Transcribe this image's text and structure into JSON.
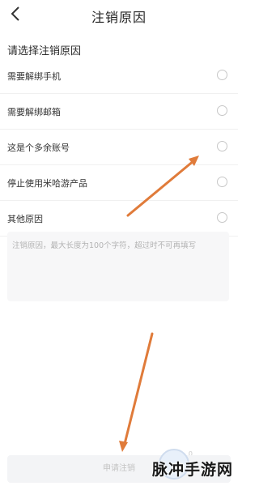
{
  "header": {
    "title": "注销原因",
    "back_icon": "chevron-left-icon"
  },
  "section": {
    "title": "请选择注销原因"
  },
  "options": [
    {
      "label": "需要解绑手机",
      "selected": false
    },
    {
      "label": "需要解绑邮箱",
      "selected": false
    },
    {
      "label": "这是个多余账号",
      "selected": false
    },
    {
      "label": "停止使用米哈游产品",
      "selected": false
    },
    {
      "label": "其他原因",
      "selected": false
    }
  ],
  "reason_input": {
    "placeholder": "注销原因，最大长度为100个字符，超过时不可再填写",
    "value": ""
  },
  "submit": {
    "label": "申请注销",
    "char_count": "0"
  },
  "annotations": {
    "arrow_color": "#e07b3a"
  },
  "watermark": {
    "text": "脉冲手游网"
  }
}
